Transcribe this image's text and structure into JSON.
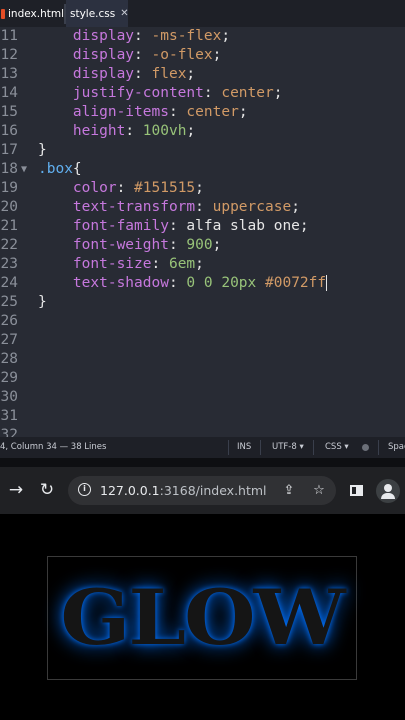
{
  "editor": {
    "tabs": [
      {
        "label": "index.html",
        "icon": "html-file-icon",
        "color": "#e44d26"
      },
      {
        "label": "style.css",
        "icon": "css-file-icon",
        "color": "#1572b6",
        "active": true
      }
    ],
    "lines": [
      {
        "n": "11",
        "tokens": [
          [
            "prop",
            "    display"
          ],
          [
            "pun",
            ": "
          ],
          [
            "val",
            "-ms-flex"
          ],
          [
            "pun",
            ";"
          ]
        ]
      },
      {
        "n": "12",
        "tokens": [
          [
            "prop",
            "    display"
          ],
          [
            "pun",
            ": "
          ],
          [
            "val",
            "-o-flex"
          ],
          [
            "pun",
            ";"
          ]
        ]
      },
      {
        "n": "13",
        "tokens": [
          [
            "prop",
            "    display"
          ],
          [
            "pun",
            ": "
          ],
          [
            "val",
            "flex"
          ],
          [
            "pun",
            ";"
          ]
        ]
      },
      {
        "n": "14",
        "tokens": [
          [
            "prop",
            "    justify-content"
          ],
          [
            "pun",
            ": "
          ],
          [
            "val",
            "center"
          ],
          [
            "pun",
            ";"
          ]
        ]
      },
      {
        "n": "15",
        "tokens": [
          [
            "prop",
            "    align-items"
          ],
          [
            "pun",
            ": "
          ],
          [
            "val",
            "center"
          ],
          [
            "pun",
            ";"
          ]
        ]
      },
      {
        "n": "16",
        "tokens": [
          [
            "prop",
            "    height"
          ],
          [
            "pun",
            ": "
          ],
          [
            "num",
            "100vh"
          ],
          [
            "pun",
            ";"
          ]
        ]
      },
      {
        "n": "17",
        "tokens": [
          [
            "pun",
            "}"
          ]
        ]
      },
      {
        "n": "18",
        "fold": "▼",
        "tokens": [
          [
            "sel",
            ".box"
          ],
          [
            "pun",
            "{"
          ]
        ]
      },
      {
        "n": "19",
        "tokens": [
          [
            "prop",
            "    color"
          ],
          [
            "pun",
            ": "
          ],
          [
            "val",
            "#151515"
          ],
          [
            "pun",
            ";"
          ]
        ]
      },
      {
        "n": "20",
        "tokens": [
          [
            "prop",
            "    text-transform"
          ],
          [
            "pun",
            ": "
          ],
          [
            "val",
            "uppercase"
          ],
          [
            "pun",
            ";"
          ]
        ]
      },
      {
        "n": "21",
        "tokens": [
          [
            "prop",
            "    font-family"
          ],
          [
            "pun",
            ": alfa slab one;"
          ]
        ]
      },
      {
        "n": "22",
        "tokens": [
          [
            "prop",
            "    font-weight"
          ],
          [
            "pun",
            ": "
          ],
          [
            "num",
            "900"
          ],
          [
            "pun",
            ";"
          ]
        ]
      },
      {
        "n": "23",
        "tokens": [
          [
            "prop",
            "    font-size"
          ],
          [
            "pun",
            ": "
          ],
          [
            "num",
            "6em"
          ],
          [
            "pun",
            ";"
          ]
        ]
      },
      {
        "n": "24",
        "cursor": true,
        "tokens": [
          [
            "prop",
            "    text-shadow"
          ],
          [
            "pun",
            ": "
          ],
          [
            "num",
            "0 0 20px"
          ],
          [
            "pun",
            " "
          ],
          [
            "val",
            "#0072ff"
          ]
        ]
      },
      {
        "n": "25",
        "tokens": [
          [
            "pun",
            "}"
          ]
        ]
      },
      {
        "n": "26",
        "tokens": []
      },
      {
        "n": "27",
        "tokens": []
      },
      {
        "n": "28",
        "tokens": []
      },
      {
        "n": "29",
        "tokens": []
      },
      {
        "n": "30",
        "tokens": []
      },
      {
        "n": "31",
        "tokens": []
      },
      {
        "n": "32",
        "tokens": []
      }
    ],
    "status": {
      "position": "4, Column 34 — 38 Lines",
      "mode": "INS",
      "encoding": "UTF-8 ▾",
      "language": "CSS ▾",
      "spaces": "Spac"
    }
  },
  "browser": {
    "url_host": "127.0.0.1",
    "url_path": ":3168/index.html",
    "icons": [
      "forward-arrow-icon",
      "reload-icon",
      "site-info-icon",
      "install-icon",
      "bookmark-star-icon",
      "side-panel-icon",
      "profile-icon"
    ]
  },
  "page": {
    "glow_text": "GLOW",
    "text_color": "#151515",
    "glow_color": "#0072ff"
  }
}
